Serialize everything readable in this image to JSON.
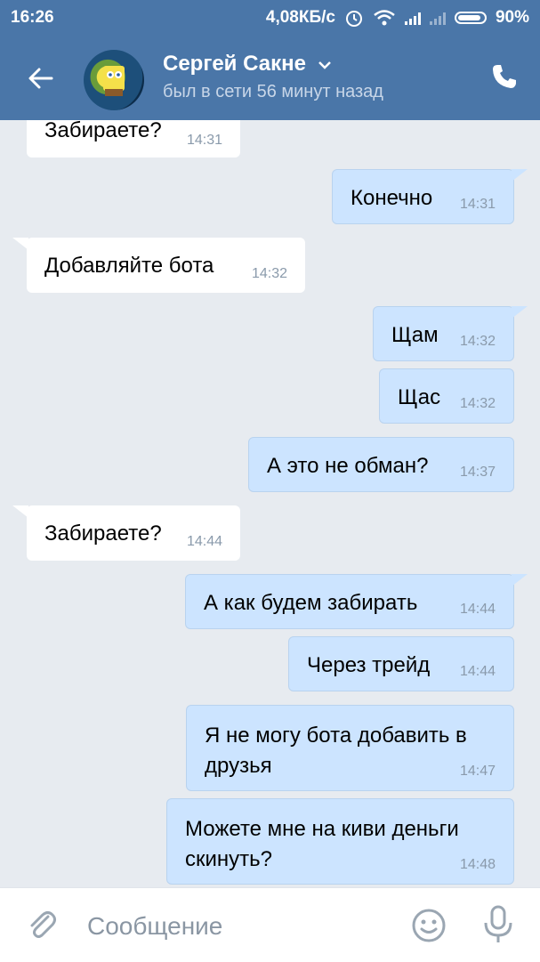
{
  "status_bar": {
    "time": "16:26",
    "speed": "4,08КБ/с",
    "battery": "90%"
  },
  "header": {
    "name": "Сергей Сакне",
    "last_seen": "был в сети 56 минут назад",
    "accent_color": "#4a76a8"
  },
  "messages": [
    {
      "dir": "in",
      "text": "Забираете?",
      "time": "14:31"
    },
    {
      "dir": "out",
      "text": "Конечно",
      "time": "14:31"
    },
    {
      "dir": "in",
      "text": "Добавляйте бота",
      "time": "14:32"
    },
    {
      "dir": "out",
      "text": "Щам",
      "time": "14:32"
    },
    {
      "dir": "out",
      "text": "Щас",
      "time": "14:32"
    },
    {
      "dir": "out",
      "text": "А это не обман?",
      "time": "14:37"
    },
    {
      "dir": "in",
      "text": "Забираете?",
      "time": "14:44"
    },
    {
      "dir": "out",
      "text": "А как будем забирать",
      "time": "14:44"
    },
    {
      "dir": "out",
      "text": "Через трейд",
      "time": "14:44"
    },
    {
      "dir": "out",
      "text": "Я не могу бота добавить в друзья",
      "time": "14:47"
    },
    {
      "dir": "out",
      "text": "Можете мне на киви деньги скинуть?",
      "time": "14:48"
    }
  ],
  "composer": {
    "placeholder": "Сообщение"
  },
  "icons": {
    "back": "back-arrow-icon",
    "call": "phone-icon",
    "attach": "paperclip-icon",
    "emoji": "smile-icon",
    "voice": "microphone-icon"
  }
}
